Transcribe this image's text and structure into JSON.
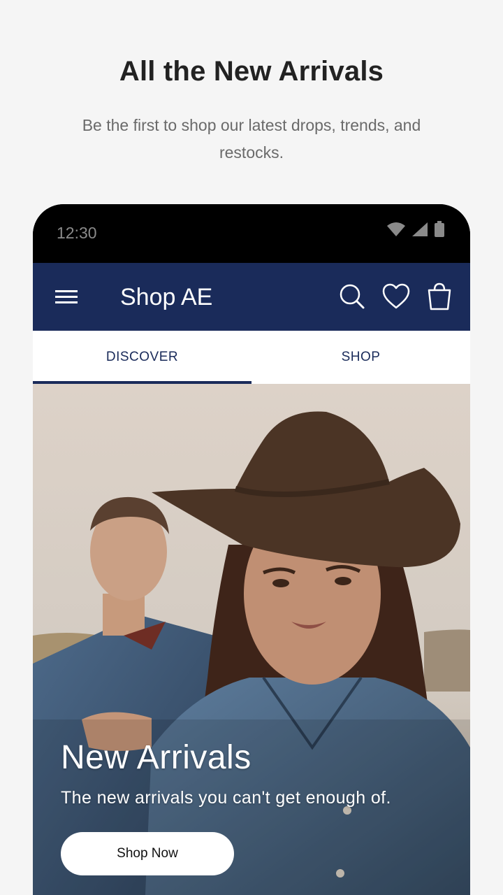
{
  "promo": {
    "title": "All the New Arrivals",
    "subtitle": "Be the first to shop our latest drops, trends, and restocks."
  },
  "status_bar": {
    "time": "12:30",
    "icons": [
      "wifi-icon",
      "signal-icon",
      "battery-icon"
    ]
  },
  "app_bar": {
    "title": "Shop AE",
    "icons": [
      "menu-icon",
      "search-icon",
      "heart-icon",
      "bag-icon"
    ],
    "color": "#1a2b5a"
  },
  "tabs": [
    {
      "label": "DISCOVER",
      "selected": true
    },
    {
      "label": "SHOP",
      "selected": false
    }
  ],
  "hero": {
    "heading": "New Arrivals",
    "subheading": "The new arrivals you can't get enough of.",
    "cta": "Shop Now"
  }
}
